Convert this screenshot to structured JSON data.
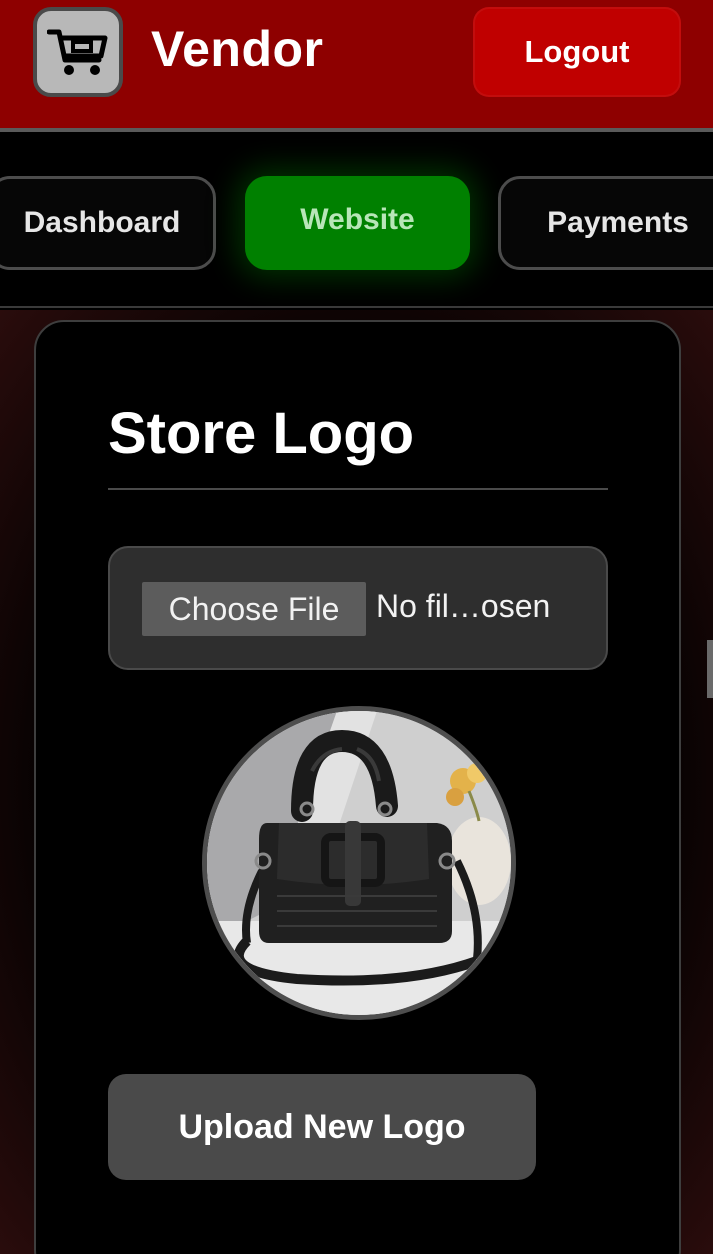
{
  "header": {
    "brand": "Vendor",
    "logout_label": "Logout",
    "logo_icon": "shopping-cart-icon",
    "colors": {
      "header_bg": "#8e0000",
      "logout_bg": "#c00000"
    }
  },
  "nav": {
    "tabs": [
      {
        "label": "Dashboard",
        "active": false
      },
      {
        "label": "Website",
        "active": true
      },
      {
        "label": "Payments",
        "active": false
      }
    ],
    "colors": {
      "active_tab": "#008000"
    }
  },
  "store_logo": {
    "title": "Store Logo",
    "file_button_label": "Choose File",
    "file_status": "No fil…osen",
    "preview_icon": "handbag-photo",
    "upload_button_label": "Upload New Logo"
  }
}
